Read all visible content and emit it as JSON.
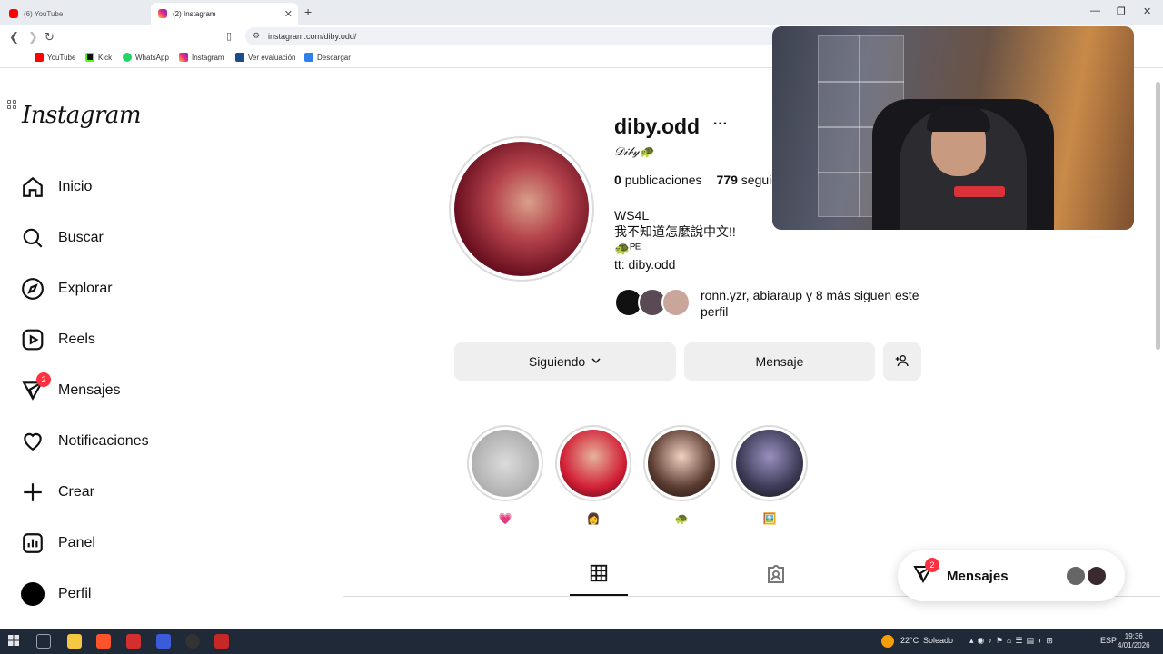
{
  "browser": {
    "tabs": [
      {
        "label": "(6) YouTube",
        "active": false
      },
      {
        "label": "(2) Instagram",
        "active": true
      }
    ],
    "url": "instagram.com/diby.odd/",
    "bookmarks": [
      "YouTube",
      "Kick",
      "WhatsApp",
      "Instagram",
      "Ver evaluación",
      "Descargar"
    ]
  },
  "sidebar": {
    "logo": "Instagram",
    "items": [
      {
        "label": "Inicio",
        "icon": "home-icon"
      },
      {
        "label": "Buscar",
        "icon": "search-icon"
      },
      {
        "label": "Explorar",
        "icon": "compass-icon"
      },
      {
        "label": "Reels",
        "icon": "reels-icon"
      },
      {
        "label": "Mensajes",
        "icon": "messenger-icon",
        "badge": "2"
      },
      {
        "label": "Notificaciones",
        "icon": "heart-icon"
      },
      {
        "label": "Crear",
        "icon": "plus-icon"
      },
      {
        "label": "Panel",
        "icon": "panel-icon"
      },
      {
        "label": "Perfil",
        "icon": "profile-icon"
      }
    ]
  },
  "profile": {
    "username": "diby.odd",
    "more": "···",
    "fullname": "𝒟𝒾𝒷𝓎",
    "posts_count": "0",
    "posts_label": "publicaciones",
    "followers_count": "779",
    "followers_label": "seguidores",
    "bio": [
      "WS4L",
      "我不知道怎麼說中文!!",
      "🐢ᴾᴱ",
      "tt: diby.odd"
    ],
    "followed_by_users": "ronn.yzr, abiaraup",
    "followed_by_rest": " y 8 más siguen este perfil",
    "buttons": {
      "following": "Siguiendo",
      "message": "Mensaje"
    }
  },
  "highlights": [
    {
      "label": "💗",
      "color": "#b9b9b9"
    },
    {
      "label": "👩",
      "color": "#d21e36"
    },
    {
      "label": "🐢",
      "color": "#5a3b30"
    },
    {
      "label": "🖼️",
      "color": "#3b3a55"
    }
  ],
  "messages_float": {
    "label": "Mensajes",
    "badge": "2"
  },
  "taskbar": {
    "weather_temp": "22°C",
    "weather_text": "Soleado",
    "lang": "ESP",
    "time": "19:36",
    "date": "4/01/2026"
  }
}
